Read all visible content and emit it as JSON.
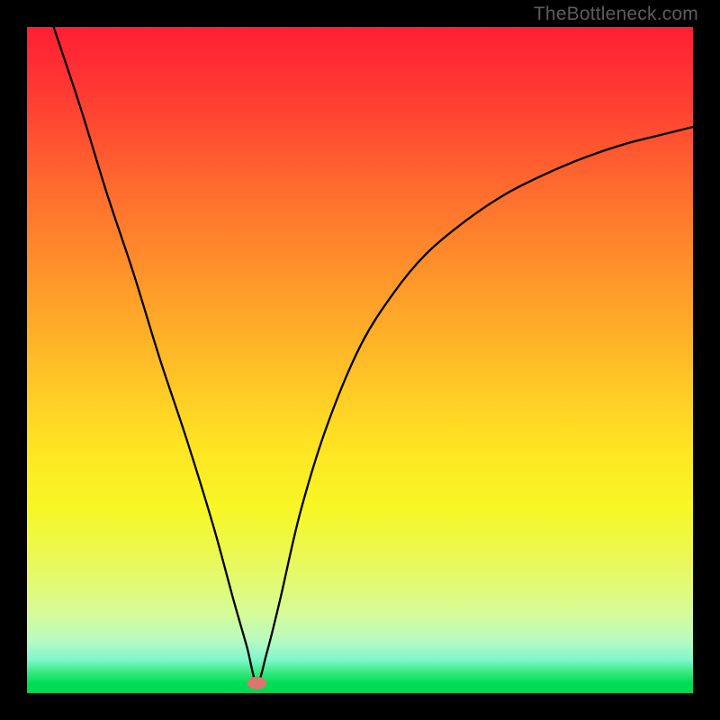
{
  "attribution": "TheBottleneck.com",
  "chart_data": {
    "type": "line",
    "title": "",
    "xlabel": "",
    "ylabel": "",
    "xlim": [
      0,
      100
    ],
    "ylim": [
      0,
      100
    ],
    "marker": {
      "x_pct": 34.5,
      "y_pct": 1.5
    },
    "series": [
      {
        "name": "curve",
        "x": [
          4,
          8,
          12,
          16,
          20,
          24,
          28,
          31,
          33,
          34.5,
          36,
          38,
          41,
          45,
          50,
          55,
          60,
          66,
          72,
          78,
          84,
          90,
          96,
          100
        ],
        "y": [
          100,
          88,
          75,
          63,
          50,
          38,
          25,
          14,
          7,
          1.5,
          6,
          14,
          27,
          40,
          52,
          60,
          66,
          71,
          75,
          78,
          80.5,
          82.5,
          84,
          85
        ]
      }
    ],
    "background_gradient": {
      "top": "#ff1f33",
      "middle": "#ffe423",
      "bottom": "#00d84e"
    }
  }
}
